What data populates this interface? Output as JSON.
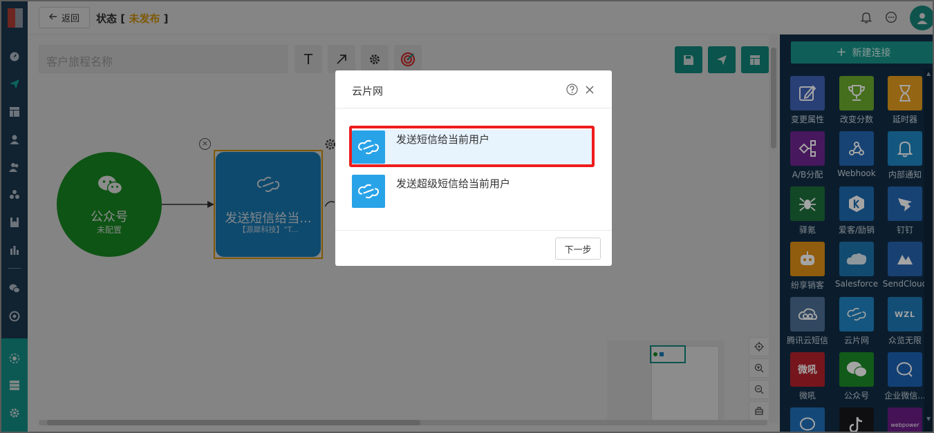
{
  "header": {
    "back_label": "返回",
    "status_label": "状态",
    "status_open": "[",
    "status_value": "未发布",
    "status_close": "]"
  },
  "toolbar": {
    "journey_name_placeholder": "客户旅程名称",
    "text_tool_glyph": "T"
  },
  "canvas": {
    "wechat_node": {
      "title": "公众号",
      "subtitle": "未配置"
    },
    "sms_node": {
      "title": "发送短信给当...",
      "subtitle": "【源犀科技】\"T..."
    }
  },
  "right_panel": {
    "new_connection_label": "新建连接",
    "tiles": [
      {
        "label": "变更属性",
        "color": "#3f63b8",
        "icon": "edit-icon"
      },
      {
        "label": "改变分数",
        "color": "#6bab2c",
        "icon": "trophy-icon"
      },
      {
        "label": "延时器",
        "color": "#e59c1a",
        "icon": "hourglass-icon"
      },
      {
        "label": "A/B分配",
        "color": "#6d2490",
        "icon": "ab-split-icon"
      },
      {
        "label": "Webhook",
        "color": "#2267b4",
        "icon": "webhook-icon"
      },
      {
        "label": "内部通知",
        "color": "#1c87c6",
        "icon": "bell-icon"
      },
      {
        "label": "驿氪",
        "color": "#1c6f3a",
        "icon": "spider-icon"
      },
      {
        "label": "爱客/励销",
        "color": "#1a6bb0",
        "icon": "k-icon"
      },
      {
        "label": "钉钉",
        "color": "#2366b3",
        "icon": "dingtalk-icon"
      },
      {
        "label": "纷享销客",
        "color": "#e08f12",
        "icon": "robot-icon"
      },
      {
        "label": "Salesforce",
        "color": "#1a74ad",
        "icon": "salesforce-icon"
      },
      {
        "label": "SendCloud",
        "color": "#2465b0",
        "icon": "sendcloud-icon"
      },
      {
        "label": "腾讯云短信",
        "color": "#4b6f95",
        "icon": "cloud-icon"
      },
      {
        "label": "云片网",
        "color": "#1d86c5",
        "icon": "yunpian-icon"
      },
      {
        "label": "众览无限",
        "color": "#1c78b8",
        "icon": "wzl-icon"
      },
      {
        "label": "微吼",
        "color": "#b8202b",
        "icon": "vhall-icon"
      },
      {
        "label": "公众号",
        "color": "#1a8c26",
        "icon": "wechat-icon"
      },
      {
        "label": "企业微信...",
        "color": "#1b63b5",
        "icon": "wework-icon"
      },
      {
        "label": "",
        "color": "#1d6fbb",
        "icon": "chat-icon"
      },
      {
        "label": "",
        "color": "#15151a",
        "icon": "tiktok-icon"
      },
      {
        "label": "",
        "color": "#6b1b84",
        "icon": "webpower-icon",
        "text": "webpower"
      }
    ]
  },
  "dialog": {
    "title": "云片网",
    "options": [
      {
        "label": "发送短信给当前用户"
      },
      {
        "label": "发送超级短信给当前用户"
      }
    ],
    "next_label": "下一步"
  },
  "tile_text": {
    "vhall": "微吼",
    "wzl": "WZL"
  }
}
